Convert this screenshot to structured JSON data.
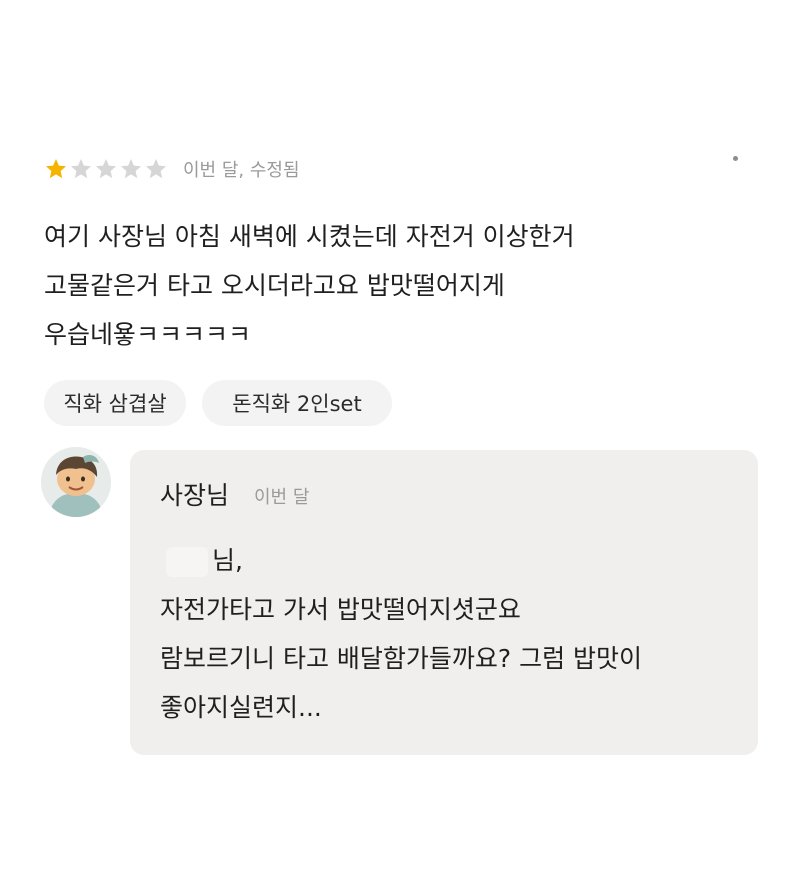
{
  "review": {
    "rating": 1,
    "max_rating": 5,
    "meta": "이번 달, 수정됨",
    "colors": {
      "star_filled": "#f5b400",
      "star_empty": "#d6d6d6"
    },
    "lines": [
      "여기 사장님 아침 새벽에 시켰는데 자전거 이상한거",
      "고물같은거 타고 오시더라고요 밥맛떨어지게",
      "우습네욯ㅋㅋㅋㅋㅋ"
    ],
    "tags": [
      "직화 삼겹살",
      "돈직화 2인set"
    ]
  },
  "reply": {
    "author": "사장님",
    "time": "이번 달",
    "greeting": "님,",
    "lines": [
      "자전가타고 가서 밥맛떨어지셧군요",
      "람보르기니 타고 배달함가들까요? 그럼 밥맛이",
      "좋아지실련지..."
    ],
    "colors": {
      "bubble_bg": "#f0efed"
    }
  },
  "icons": {
    "more": "more-icon",
    "star": "star-icon",
    "avatar": "avatar"
  }
}
